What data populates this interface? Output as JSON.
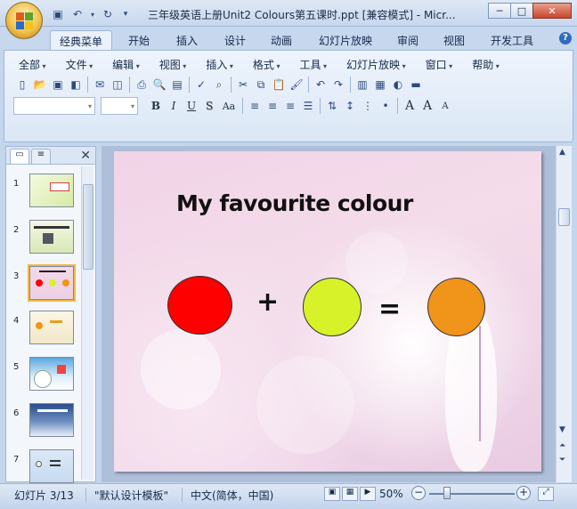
{
  "window": {
    "title": "三年级英语上册Unit2 Colours第五课时.ppt [兼容模式] - Micr...",
    "controls": {
      "minimize": "─",
      "maximize": "□",
      "close": "✕"
    }
  },
  "quick_access": [
    {
      "name": "save-icon",
      "glyph": "💾"
    },
    {
      "name": "undo-icon",
      "glyph": "↶"
    },
    {
      "name": "undo-dropdown-icon",
      "glyph": "▾"
    },
    {
      "name": "redo-icon",
      "glyph": "↻"
    },
    {
      "name": "customize-qat-icon",
      "glyph": "▾"
    }
  ],
  "ribbon_tabs": [
    "经典菜单",
    "开始",
    "插入",
    "设计",
    "动画",
    "幻灯片放映",
    "审阅",
    "视图",
    "开发工具"
  ],
  "active_tab": "经典菜单",
  "classic_menu": [
    "全部",
    "文件",
    "编辑",
    "视图",
    "插入",
    "格式",
    "工具",
    "幻灯片放映",
    "窗口",
    "帮助"
  ],
  "format_buttons": {
    "bold": "B",
    "italic": "I",
    "underline": "U",
    "shadow": "S",
    "change_case": "Aa",
    "font_grow": "A",
    "font_shrink": "A"
  },
  "slides_pane": {
    "slide_numbers": [
      "1",
      "2",
      "3",
      "4",
      "5",
      "6",
      "7"
    ],
    "selected": "3"
  },
  "slide": {
    "title": "My favourite colour",
    "plus": "+",
    "equals": "=",
    "colors": {
      "left": "#ff0000",
      "middle": "#d8f22a",
      "right": "#f0941a"
    }
  },
  "status": {
    "slide_counter": "幻灯片 3/13",
    "theme": "\"默认设计模板\"",
    "language": "中文(简体，中国)",
    "zoom": "50%"
  }
}
